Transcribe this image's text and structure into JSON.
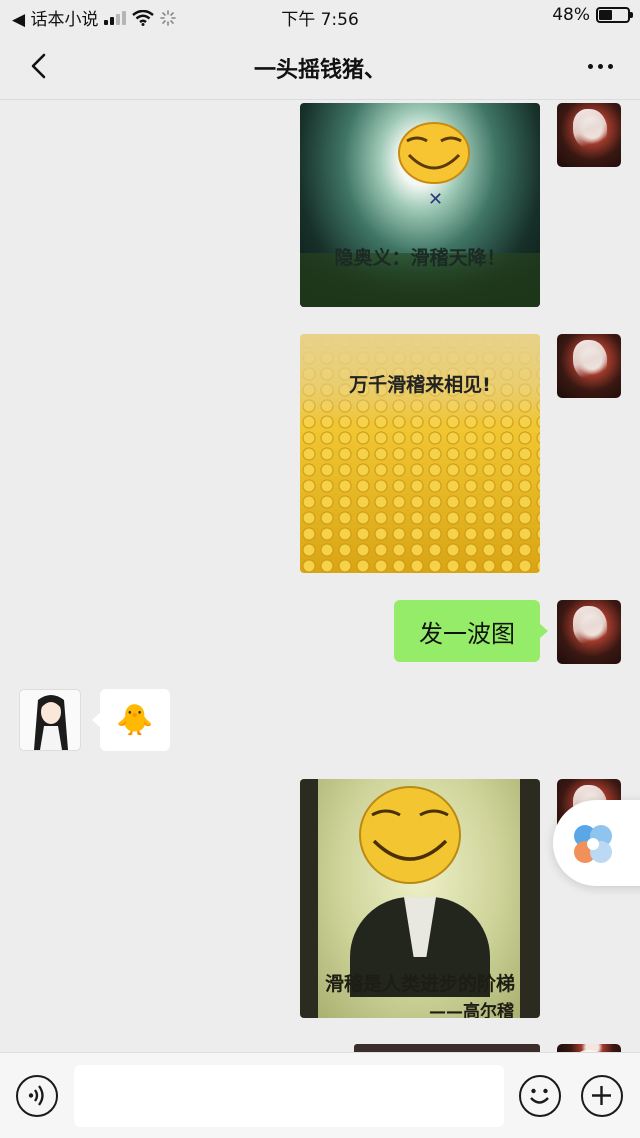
{
  "status_bar": {
    "back_app": "◀ 话本小说",
    "time": "下午 7:56",
    "battery_percent": "48%",
    "battery_level": 0.48,
    "signal_bars": 2
  },
  "nav": {
    "title": "一头摇钱猪、",
    "back_icon": "chevron-left-icon",
    "more_icon": "more-dots-icon"
  },
  "messages": [
    {
      "sender": "self",
      "type": "image",
      "caption": "隐奥义：滑稽天降！"
    },
    {
      "sender": "self",
      "type": "image",
      "caption": "万千滑稽来相见!"
    },
    {
      "sender": "self",
      "type": "text",
      "text": "发一波图"
    },
    {
      "sender": "other",
      "type": "emoji",
      "emoji": "🐥"
    },
    {
      "sender": "self",
      "type": "image",
      "caption": "滑稽是人类进步的阶梯",
      "caption2": "——高尔稽"
    }
  ],
  "input_bar": {
    "voice_icon": "voice-icon",
    "emoji_icon": "emoji-icon",
    "plus_icon": "plus-icon",
    "value": ""
  },
  "colors": {
    "self_bubble": "#95ec69",
    "background": "#ededed",
    "other_bubble": "#ffffff"
  }
}
